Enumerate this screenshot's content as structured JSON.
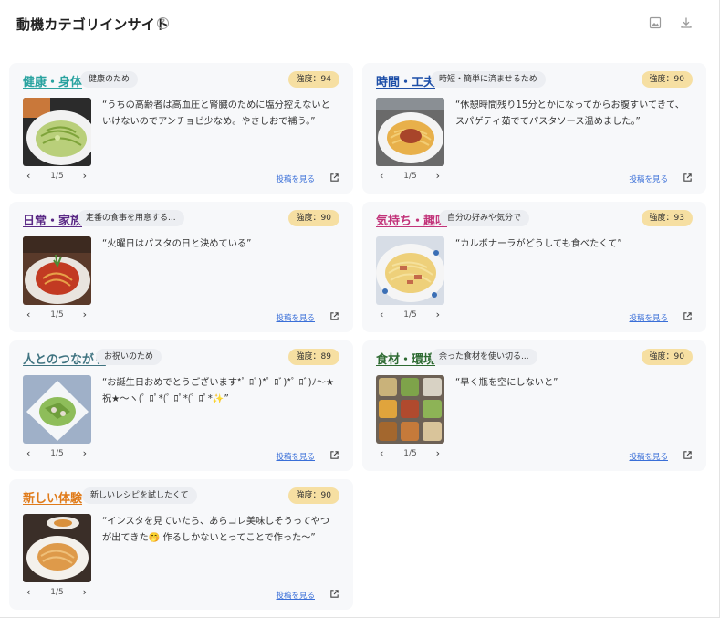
{
  "header": {
    "title": "動機カテゴリインサイト",
    "help_icon": "question-circle-icon",
    "image_icon": "image-icon",
    "download_icon": "download-icon"
  },
  "colors": {
    "badge_bg": "#f6dfa2",
    "card_bg": "#f7f8fa",
    "link": "#3a6fd8"
  },
  "cards": [
    {
      "category": "健康・身体",
      "category_color": "#2aa3a0",
      "subtitle": "健康のため",
      "strength": "強度：94",
      "quote": "“うちの高齢者は高血圧と腎臓のために塩分控えないといけないのでアンチョビ少なめ。やさしおで補う。”",
      "page": "1/5",
      "link": "投稿を見る"
    },
    {
      "category": "時間・工夫",
      "category_color": "#1e4fa8",
      "subtitle": "時短・簡単に済ませるため",
      "strength": "強度：90",
      "quote": "“休憩時間残り15分とかになってからお腹すいてきて、スパゲティ茹でてパスタソース温めました。”",
      "page": "1/5",
      "link": "投稿を見る"
    },
    {
      "category": "日常・家族",
      "category_color": "#5b2a86",
      "subtitle": "定番の食事を用意する...",
      "strength": "強度：90",
      "quote": "“火曜日はパスタの日と決めている”",
      "page": "1/5",
      "link": "投稿を見る"
    },
    {
      "category": "気持ち・趣味",
      "category_color": "#c2347a",
      "subtitle": "自分の好みや気分で",
      "strength": "強度：93",
      "quote": "“カルボナーラがどうしても食べたくて”",
      "page": "1/5",
      "link": "投稿を見る"
    },
    {
      "category": "人とのつながり",
      "category_color": "#3f7380",
      "subtitle": "お祝いのため",
      "strength": "強度：89",
      "quote": "“お誕生日おめでとうございます*ﾟ ﾛﾞ)*ﾟ ﾛﾞ)*ﾟ ﾛﾞ)ﾉ～★祝★～ヽ(ﾟ ﾛﾟ*(ﾟ ﾛﾟ*(ﾟ ﾛﾟ*✨”",
      "page": "1/5",
      "link": "投稿を見る"
    },
    {
      "category": "食材・環境",
      "category_color": "#2f6b33",
      "subtitle": "余った食材を使い切る...",
      "strength": "強度：90",
      "quote": "“早く瓶を空にしないと”",
      "page": "1/5",
      "link": "投稿を見る"
    },
    {
      "category": "新しい体験",
      "category_color": "#e07b1a",
      "subtitle": "新しいレシピを試したくて",
      "strength": "強度：90",
      "quote": "“インスタを見ていたら、あらコレ美味しそうってやつが出てきた🤭 作るしかないとってことで作った～”",
      "page": "1/5",
      "link": "投稿を見る"
    }
  ]
}
